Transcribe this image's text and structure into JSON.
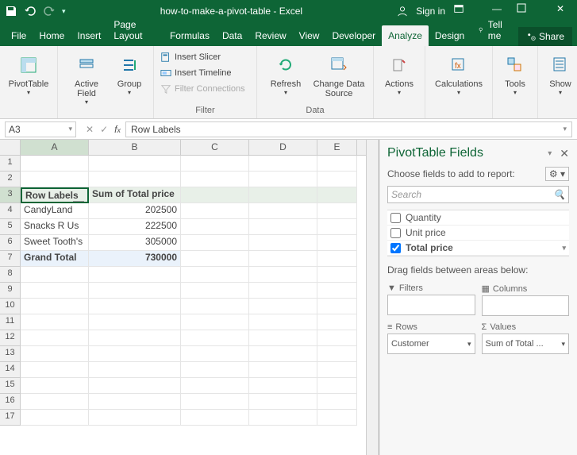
{
  "app": {
    "title": "how-to-make-a-pivot-table - Excel",
    "signin": "Sign in"
  },
  "tabs": {
    "file": "File",
    "home": "Home",
    "insert": "Insert",
    "pagelayout": "Page Layout",
    "formulas": "Formulas",
    "data": "Data",
    "review": "Review",
    "view": "View",
    "developer": "Developer",
    "analyze": "Analyze",
    "design": "Design",
    "tellme": "Tell me",
    "share": "Share"
  },
  "ribbon": {
    "pivottable": "PivotTable",
    "activefield": "Active Field",
    "group": "Group",
    "insertslicer": "Insert Slicer",
    "inserttimeline": "Insert Timeline",
    "filterconnections": "Filter Connections",
    "filter_label": "Filter",
    "refresh": "Refresh",
    "changedatasource": "Change Data Source",
    "data_label": "Data",
    "actions": "Actions",
    "calculations": "Calculations",
    "tools": "Tools",
    "show": "Show"
  },
  "namebox": "A3",
  "formula": "Row Labels",
  "columns": [
    "A",
    "B",
    "C",
    "D",
    "E"
  ],
  "sheet": {
    "r3a": "Row Labels",
    "r3b": "Sum of Total price",
    "r4a": "CandyLand",
    "r4b": "202500",
    "r5a": "Snacks R Us",
    "r5b": "222500",
    "r6a": "Sweet Tooth's",
    "r6b": "305000",
    "r7a": "Grand Total",
    "r7b": "730000"
  },
  "pane": {
    "title": "PivotTable Fields",
    "choose": "Choose fields to add to report:",
    "search": "Search",
    "field_quantity": "Quantity",
    "field_unitprice": "Unit price",
    "field_totalprice": "Total price",
    "drag": "Drag fields between areas below:",
    "filters": "Filters",
    "columns_area": "Columns",
    "rows": "Rows",
    "values": "Values",
    "rows_item": "Customer",
    "values_item": "Sum of Total ..."
  },
  "chart_data": {
    "type": "table",
    "title": "Sum of Total price by Customer",
    "categories": [
      "CandyLand",
      "Snacks R Us",
      "Sweet Tooth's"
    ],
    "values": [
      202500,
      222500,
      305000
    ],
    "grand_total": 730000
  }
}
